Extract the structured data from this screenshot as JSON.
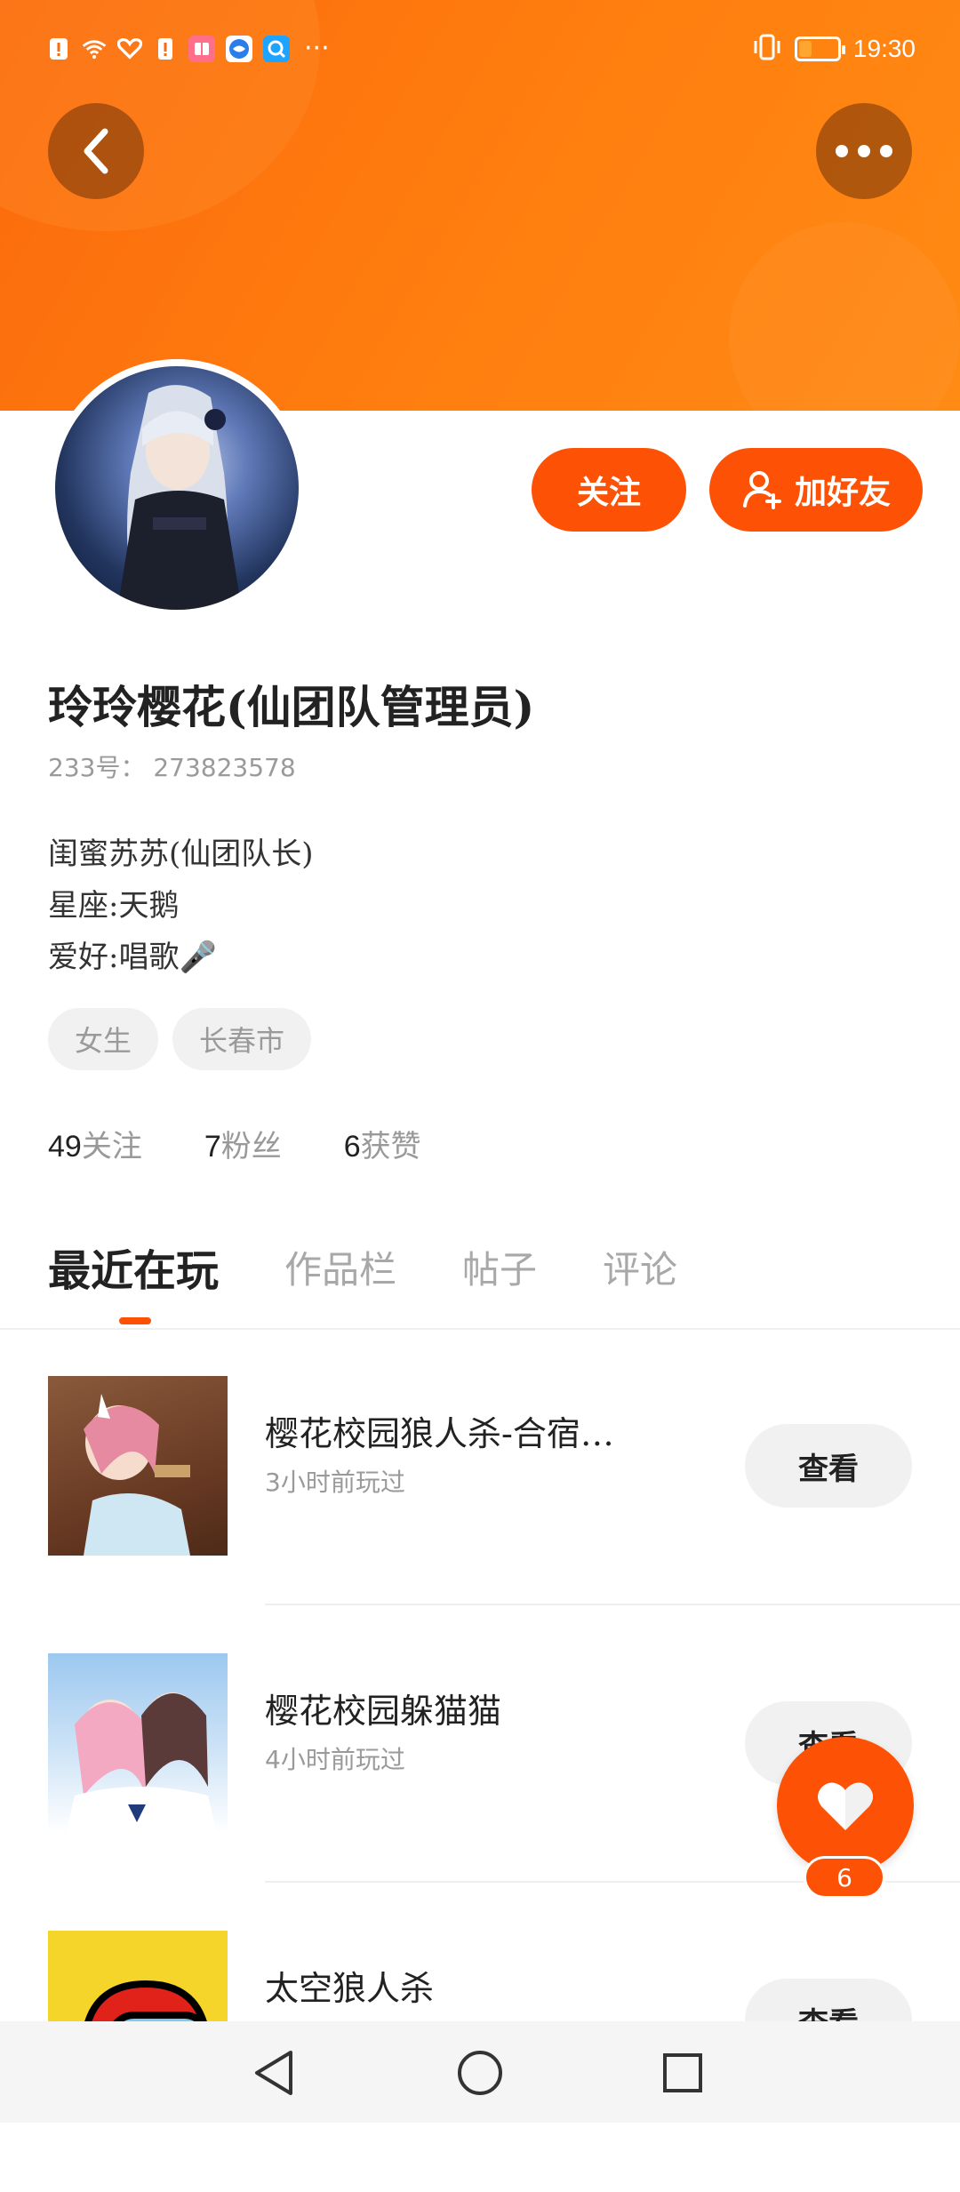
{
  "status_bar": {
    "time": "19:30",
    "battery_level": 0.3,
    "more": "···"
  },
  "profile": {
    "name": "玲玲樱花(仙团队管理员)",
    "uid_label": "233号：",
    "uid_value": "273823578",
    "bio_lines": [
      "闺蜜苏苏(仙团队长)",
      "星座:天鹅",
      "爱好:唱歌🎤"
    ],
    "tags": [
      "女生",
      "长春市"
    ],
    "stats": [
      {
        "num": "49",
        "label": "关注"
      },
      {
        "num": "7",
        "label": "粉丝"
      },
      {
        "num": "6",
        "label": "获赞"
      }
    ]
  },
  "actions": {
    "follow_label": "关注",
    "add_friend_label": "加好友"
  },
  "tabs": [
    "最近在玩",
    "作品栏",
    "帖子",
    "评论"
  ],
  "games": [
    {
      "title": "樱花校园狼人杀-合宿…",
      "sub": "3小时前玩过",
      "button": "查看"
    },
    {
      "title": "樱花校园躲猫猫",
      "sub": "4小时前玩过",
      "button": "查看"
    },
    {
      "title": "太空狼人杀",
      "sub": "",
      "button": "查看"
    }
  ],
  "like": {
    "count": "6"
  },
  "colors": {
    "accent": "#fd5205",
    "header": "#ff7f0f"
  }
}
